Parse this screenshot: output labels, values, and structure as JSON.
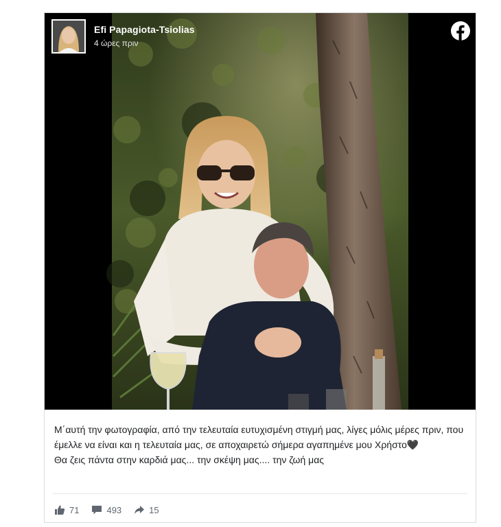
{
  "post": {
    "author_name": "Efi Papagiota-Tsiolias",
    "time": "4 ώρες πριν",
    "caption_line1": "Μ΄αυτή την φωτογραφία, από την τελευταία ευτυχισμένη στιγμή μας, λίγες μόλις μέρες πριν, που έμελλε να είναι και η τελευταία μας, σε αποχαιρετώ σήμερα αγαπημένε μου Χρήστο🖤",
    "caption_line2": "Θα ζεις πάντα στην καρδιά μας... την σκέψη μας.... την ζωή μας"
  },
  "stats": {
    "likes": "71",
    "comments": "493",
    "shares": "15"
  },
  "icons": {
    "platform": "facebook-icon",
    "like": "thumbs-up-icon",
    "comment": "comment-icon",
    "share": "share-arrow-icon"
  },
  "colors": {
    "facebook_brand": "#ffffff",
    "photo_background": "#000000",
    "meta_text": "#606770"
  }
}
